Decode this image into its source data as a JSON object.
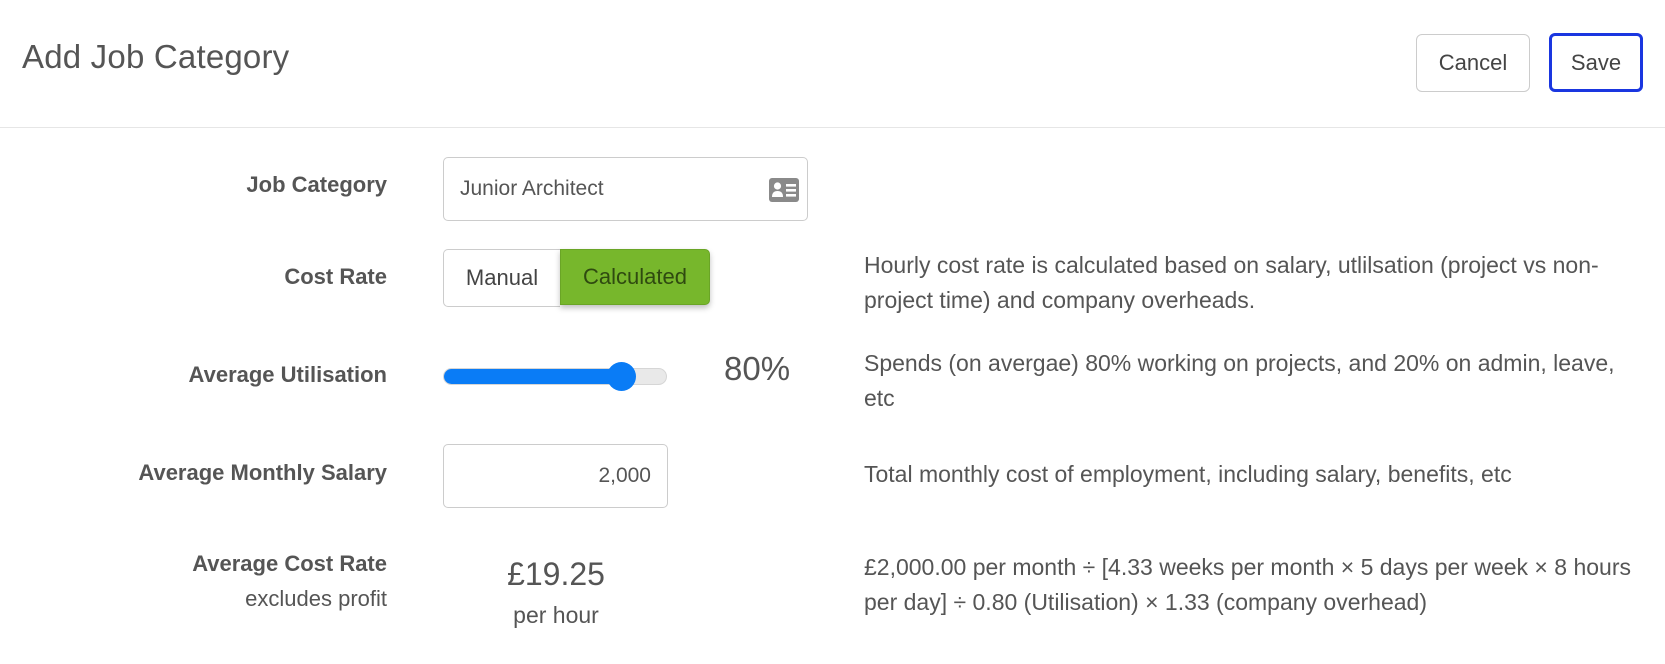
{
  "header": {
    "title": "Add Job Category",
    "cancel_label": "Cancel",
    "save_label": "Save"
  },
  "form": {
    "job_category": {
      "label": "Job Category",
      "value": "Junior Architect",
      "icon": "id-card-icon"
    },
    "cost_rate": {
      "label": "Cost Rate",
      "options": [
        "Manual",
        "Calculated"
      ],
      "selected": "Calculated",
      "description": "Hourly cost rate is calculated based on salary, utlilsation (project vs non-project time) and company overheads."
    },
    "average_utilisation": {
      "label": "Average Utilisation",
      "value_percent": 80,
      "display": "80%",
      "description": "Spends (on avergae) 80% working on projects, and 20% on admin, leave, etc"
    },
    "average_monthly_salary": {
      "label": "Average Monthly Salary",
      "value": "2,000",
      "description": "Total monthly cost of employment, including salary, benefits, etc"
    },
    "average_cost_rate": {
      "label": "Average Cost Rate",
      "sublabel": "excludes profit",
      "value": "£19.25",
      "unit": "per hour",
      "description": "£2,000.00 per month ÷ [4.33 weeks per month × 5 days per week × 8 hours per day] ÷ 0.80 (Utilisation) × 1.33 (company overhead)"
    }
  },
  "colors": {
    "accent_green": "#77b72c",
    "slider_blue": "#0a7cf6",
    "save_border": "#1a36e0"
  }
}
